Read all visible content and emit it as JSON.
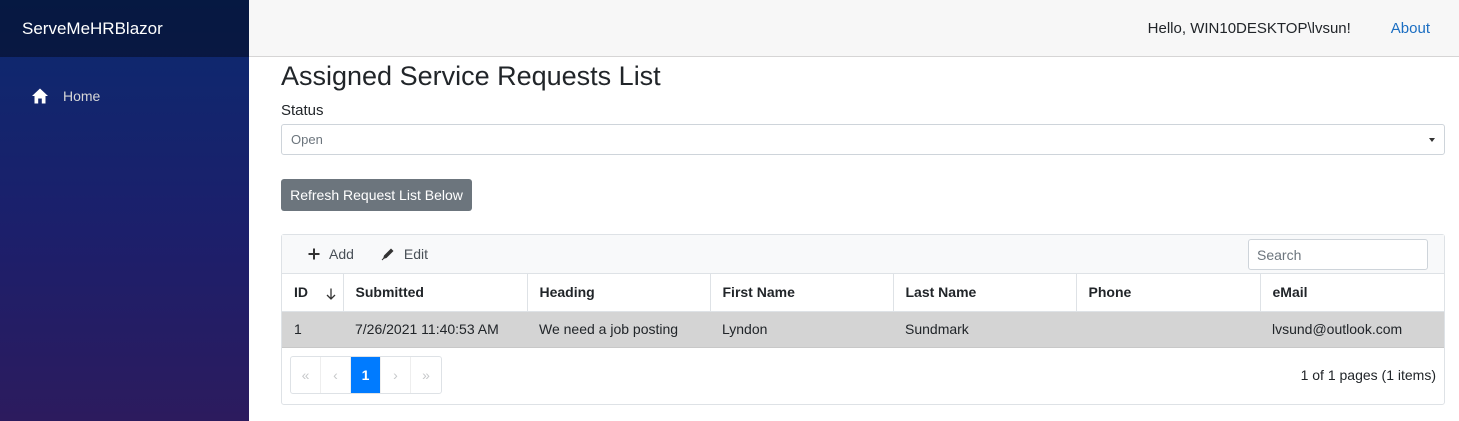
{
  "sidebar": {
    "brand": "ServeMeHRBlazor",
    "nav": [
      {
        "label": "Home",
        "icon": "home-icon"
      }
    ]
  },
  "topbar": {
    "greeting": "Hello, WIN10DESKTOP\\lvsun!",
    "about": "About"
  },
  "main": {
    "title": "Assigned Service Requests List",
    "status_label": "Status",
    "status_value": "Open",
    "refresh_button": "Refresh Request List Below"
  },
  "grid": {
    "toolbar": {
      "add": "Add",
      "edit": "Edit",
      "search_placeholder": "Search"
    },
    "columns": [
      "ID",
      "Submitted",
      "Heading",
      "First Name",
      "Last Name",
      "Phone",
      "eMail"
    ],
    "rows": [
      [
        "1",
        "7/26/2021 11:40:53 AM",
        "We need a job posting",
        "Lyndon",
        "Sundmark",
        "",
        "lvsund@outlook.com"
      ]
    ],
    "pager": {
      "first": "«",
      "prev": "‹",
      "current": "1",
      "next": "›",
      "last": "»"
    },
    "page_info": "1 of 1 pages (1 items)"
  },
  "colors": {
    "accent": "#007bff",
    "link": "#1b6ec2",
    "button": "#6c757d",
    "selected_row": "#d4d4d4"
  }
}
